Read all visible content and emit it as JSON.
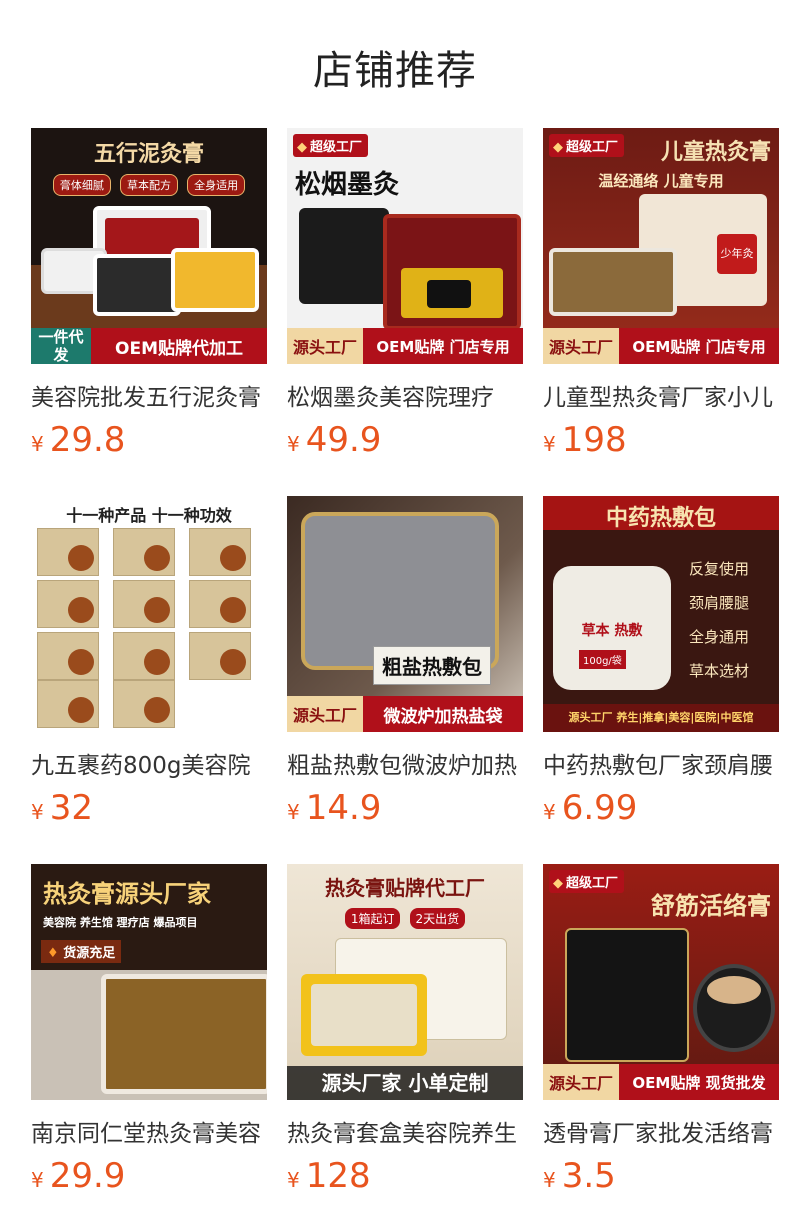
{
  "page": {
    "title": "店铺推荐"
  },
  "currency_symbol": "¥",
  "products": [
    {
      "name": "美容院批发五行泥灸膏",
      "price": "29.8",
      "image": {
        "headline": "五行泥灸膏",
        "tags": [
          "膏体细腻",
          "草本配方",
          "全身适用"
        ],
        "corner_badge": "一件代发",
        "banner": "OEM贴牌代加工"
      }
    },
    {
      "name": "松烟墨灸美容院理疗",
      "price": "49.9",
      "image": {
        "super_badge": "超级工厂",
        "headline": "松烟墨灸",
        "banner_left": "源头工厂",
        "banner_right": "OEM贴牌 门店专用"
      }
    },
    {
      "name": "儿童型热灸膏厂家小儿",
      "price": "198",
      "image": {
        "super_badge": "超级工厂",
        "headline": "儿童热灸膏",
        "subline": "温经通络 儿童专用",
        "box_label": "少年灸",
        "banner_left": "源头工厂",
        "banner_right": "OEM贴牌 门店专用"
      }
    },
    {
      "name": "九五裹药800g美容院",
      "price": "32",
      "image": {
        "headline": "十一种产品 十一种功效"
      }
    },
    {
      "name": "粗盐热敷包微波炉加热",
      "price": "14.9",
      "image": {
        "overlay_text": "粗盐热敷包",
        "banner_left": "源头工厂",
        "banner_right": "微波炉加热盐袋"
      }
    },
    {
      "name": "中药热敷包厂家颈肩腰",
      "price": "6.99",
      "image": {
        "headline": "中药热敷包",
        "bag_text": "草本 热敷",
        "bag_weight": "100g/袋",
        "features": [
          "反复使用",
          "颈肩腰腿",
          "全身通用",
          "草本选材"
        ],
        "banner": "源头工厂 养生|推拿|美容|医院|中医馆"
      }
    },
    {
      "name": "南京同仁堂热灸膏美容",
      "price": "29.9",
      "image": {
        "headline": "热灸膏源头厂家",
        "subline": "美容院 养生馆 理疗店 爆品项目",
        "tag": "货源充足"
      }
    },
    {
      "name": "热灸膏套盒美容院养生",
      "price": "128",
      "image": {
        "headline": "热灸膏贴牌代工厂",
        "tags": [
          "1箱起订",
          "2天出货"
        ],
        "banner": "源头厂家 小单定制"
      }
    },
    {
      "name": "透骨膏厂家批发活络膏",
      "price": "3.5",
      "image": {
        "super_badge": "超级工厂",
        "headline": "舒筋活络膏",
        "banner_left": "源头工厂",
        "banner_right": "OEM贴牌 现货批发"
      }
    }
  ],
  "colors": {
    "price": "#e8541e",
    "text": "#333333",
    "brand_red": "#b0101a"
  }
}
